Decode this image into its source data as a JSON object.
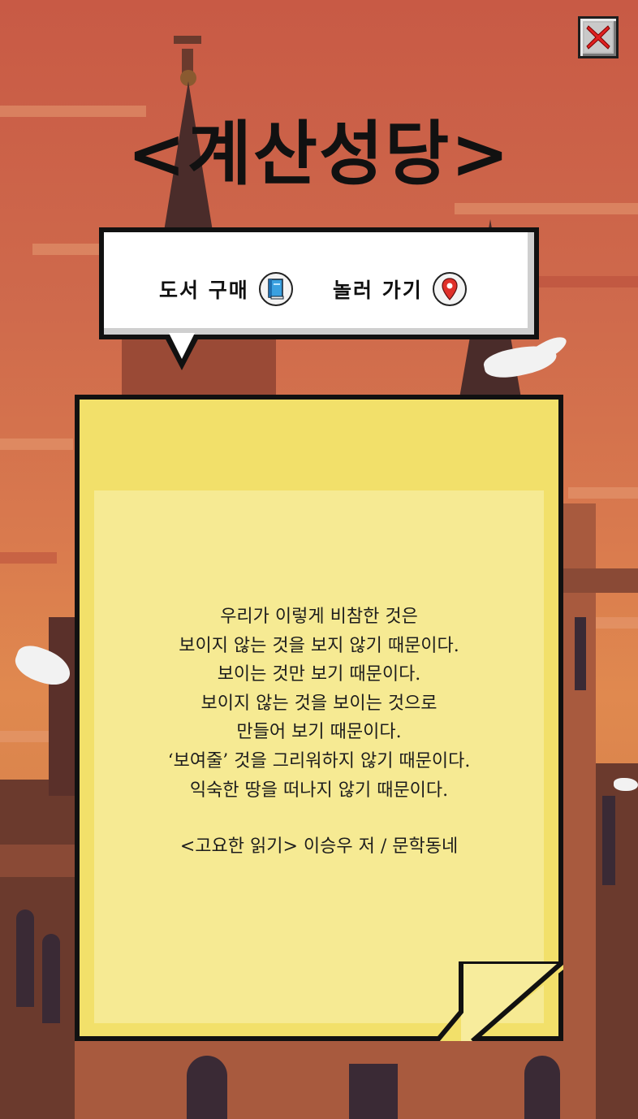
{
  "window": {
    "close_icon": "close-x-icon",
    "close_color": "#e02020"
  },
  "header": {
    "title": "<계산성당>"
  },
  "menu": {
    "buy_book_label": "도서 구매",
    "buy_book_icon": "book-icon",
    "visit_label": "놀러 가기",
    "visit_icon": "map-pin-icon"
  },
  "note": {
    "quote_lines": [
      "우리가 이렇게 비참한 것은",
      "보이지 않는 것을 보지 않기 때문이다.",
      "보이는 것만 보기 때문이다.",
      "보이지 않는 것을 보이는 것으로",
      "만들어 보기 때문이다.",
      "‘보여줄’ 것을 그리워하지 않기 때문이다.",
      "익숙한 땅을 떠나지 않기 때문이다."
    ],
    "source": "<고요한 읽기> 이승우 저 / 문학동네"
  },
  "colors": {
    "sky": "#cf6a4c",
    "note": "#f2e06a",
    "note_inner": "#f6ea93",
    "text": "#1d1d1d"
  }
}
